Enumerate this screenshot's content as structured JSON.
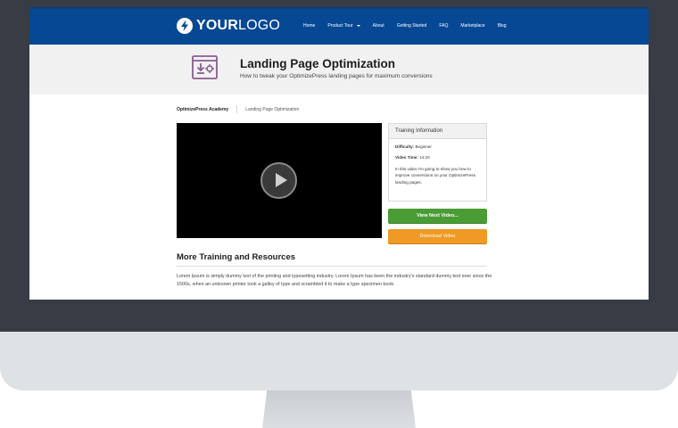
{
  "logo": {
    "bold": "YOUR",
    "regular": "LOGO",
    "icon": "lightning-bolt-icon"
  },
  "nav": {
    "items": [
      {
        "label": "Home"
      },
      {
        "label": "Product Tour"
      },
      {
        "label": "About"
      },
      {
        "label": "Getting Started"
      },
      {
        "label": "FAQ"
      },
      {
        "label": "Marketplace"
      },
      {
        "label": "Blog"
      }
    ]
  },
  "hero": {
    "icon": "download-settings-icon",
    "title": "Landing Page Optimization",
    "subtitle": "How to tweak your OptimizePress landing pages for maximum conversions"
  },
  "breadcrumb": [
    "OptimizePress Academy",
    "Landing Page Optimization"
  ],
  "video": {
    "icon": "play-icon"
  },
  "training_info": {
    "heading": "Training Information",
    "difficulty_label": "Difficulty:",
    "difficulty_value": "Beginner",
    "time_label": "Video Time:",
    "time_value": "14:20",
    "description": "In this video I'm going to show you how to improve conversions on your OptimizePress landing pages."
  },
  "buttons": {
    "next": "View Next Video...",
    "download": "Download Video"
  },
  "more": {
    "title": "More Training and Resources",
    "text": "Lorem Ipsum is simply dummy text of the printing and typesetting industry. Lorem Ipsum has been the industry's standard dummy text ever since the 1500s, when an unknown printer took a galley of type and scrambled it to make a type specimen book."
  },
  "colors": {
    "header": "#064894",
    "hero_bg": "#f1f1f1",
    "next_button": "#4a9c35",
    "download_button": "#ee9a24",
    "monitor_bezel": "#383c44",
    "monitor_chin": "#dfe2e5"
  }
}
